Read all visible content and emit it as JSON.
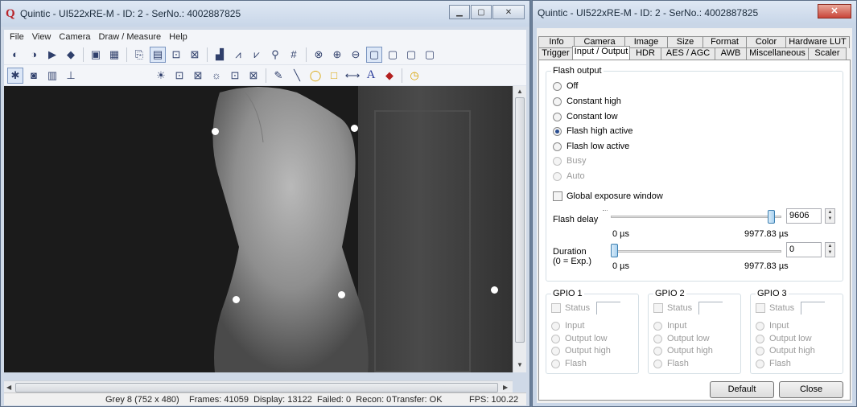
{
  "main_window": {
    "title": "Quintic - UI522xRE-M - ID: 2 - SerNo.: 4002887825",
    "menu": [
      "File",
      "View",
      "Camera",
      "Draw / Measure",
      "Help"
    ],
    "status": {
      "format": "Grey 8 (752 x 480)",
      "counters": "Frames: 41059  Display: 13122  Failed: 0  Recon: 0",
      "transfer": "Transfer: OK",
      "fps": "FPS: 100.22"
    }
  },
  "settings_window": {
    "title": "Quintic - UI522xRE-M - ID: 2 - SerNo.: 4002887825",
    "tabs_row1": [
      "Info",
      "Camera",
      "Image",
      "Size",
      "Format",
      "Color",
      "Hardware LUT"
    ],
    "tabs_row2": [
      "Trigger",
      "Input / Output",
      "HDR",
      "AES / AGC",
      "AWB",
      "Miscellaneous",
      "Scaler"
    ],
    "active_tab": "Input / Output",
    "flash_output": {
      "label": "Flash output",
      "options": [
        "Off",
        "Constant high",
        "Constant low",
        "Flash high active",
        "Flash low active",
        "Busy",
        "Auto"
      ],
      "selected": "Flash high active",
      "global_exposure": "Global exposure window"
    },
    "flash_delay": {
      "label": "Flash delay",
      "value": "9606",
      "min_label": "0 µs",
      "max_label": "9977.83 µs",
      "position": 0.963
    },
    "duration": {
      "label": "Duration",
      "sub_label": "(0 = Exp.)",
      "value": "0",
      "min_label": "0 µs",
      "max_label": "9977.83 µs",
      "position": 0.0
    },
    "gpio": [
      {
        "label": "GPIO 1",
        "status": "Status",
        "options": [
          "Input",
          "Output low",
          "Output high",
          "Flash"
        ]
      },
      {
        "label": "GPIO 2",
        "status": "Status",
        "options": [
          "Input",
          "Output low",
          "Output high",
          "Flash"
        ]
      },
      {
        "label": "GPIO 3",
        "status": "Status",
        "options": [
          "Input",
          "Output low",
          "Output high",
          "Flash"
        ]
      }
    ],
    "buttons": {
      "default": "Default",
      "close": "Close"
    }
  }
}
